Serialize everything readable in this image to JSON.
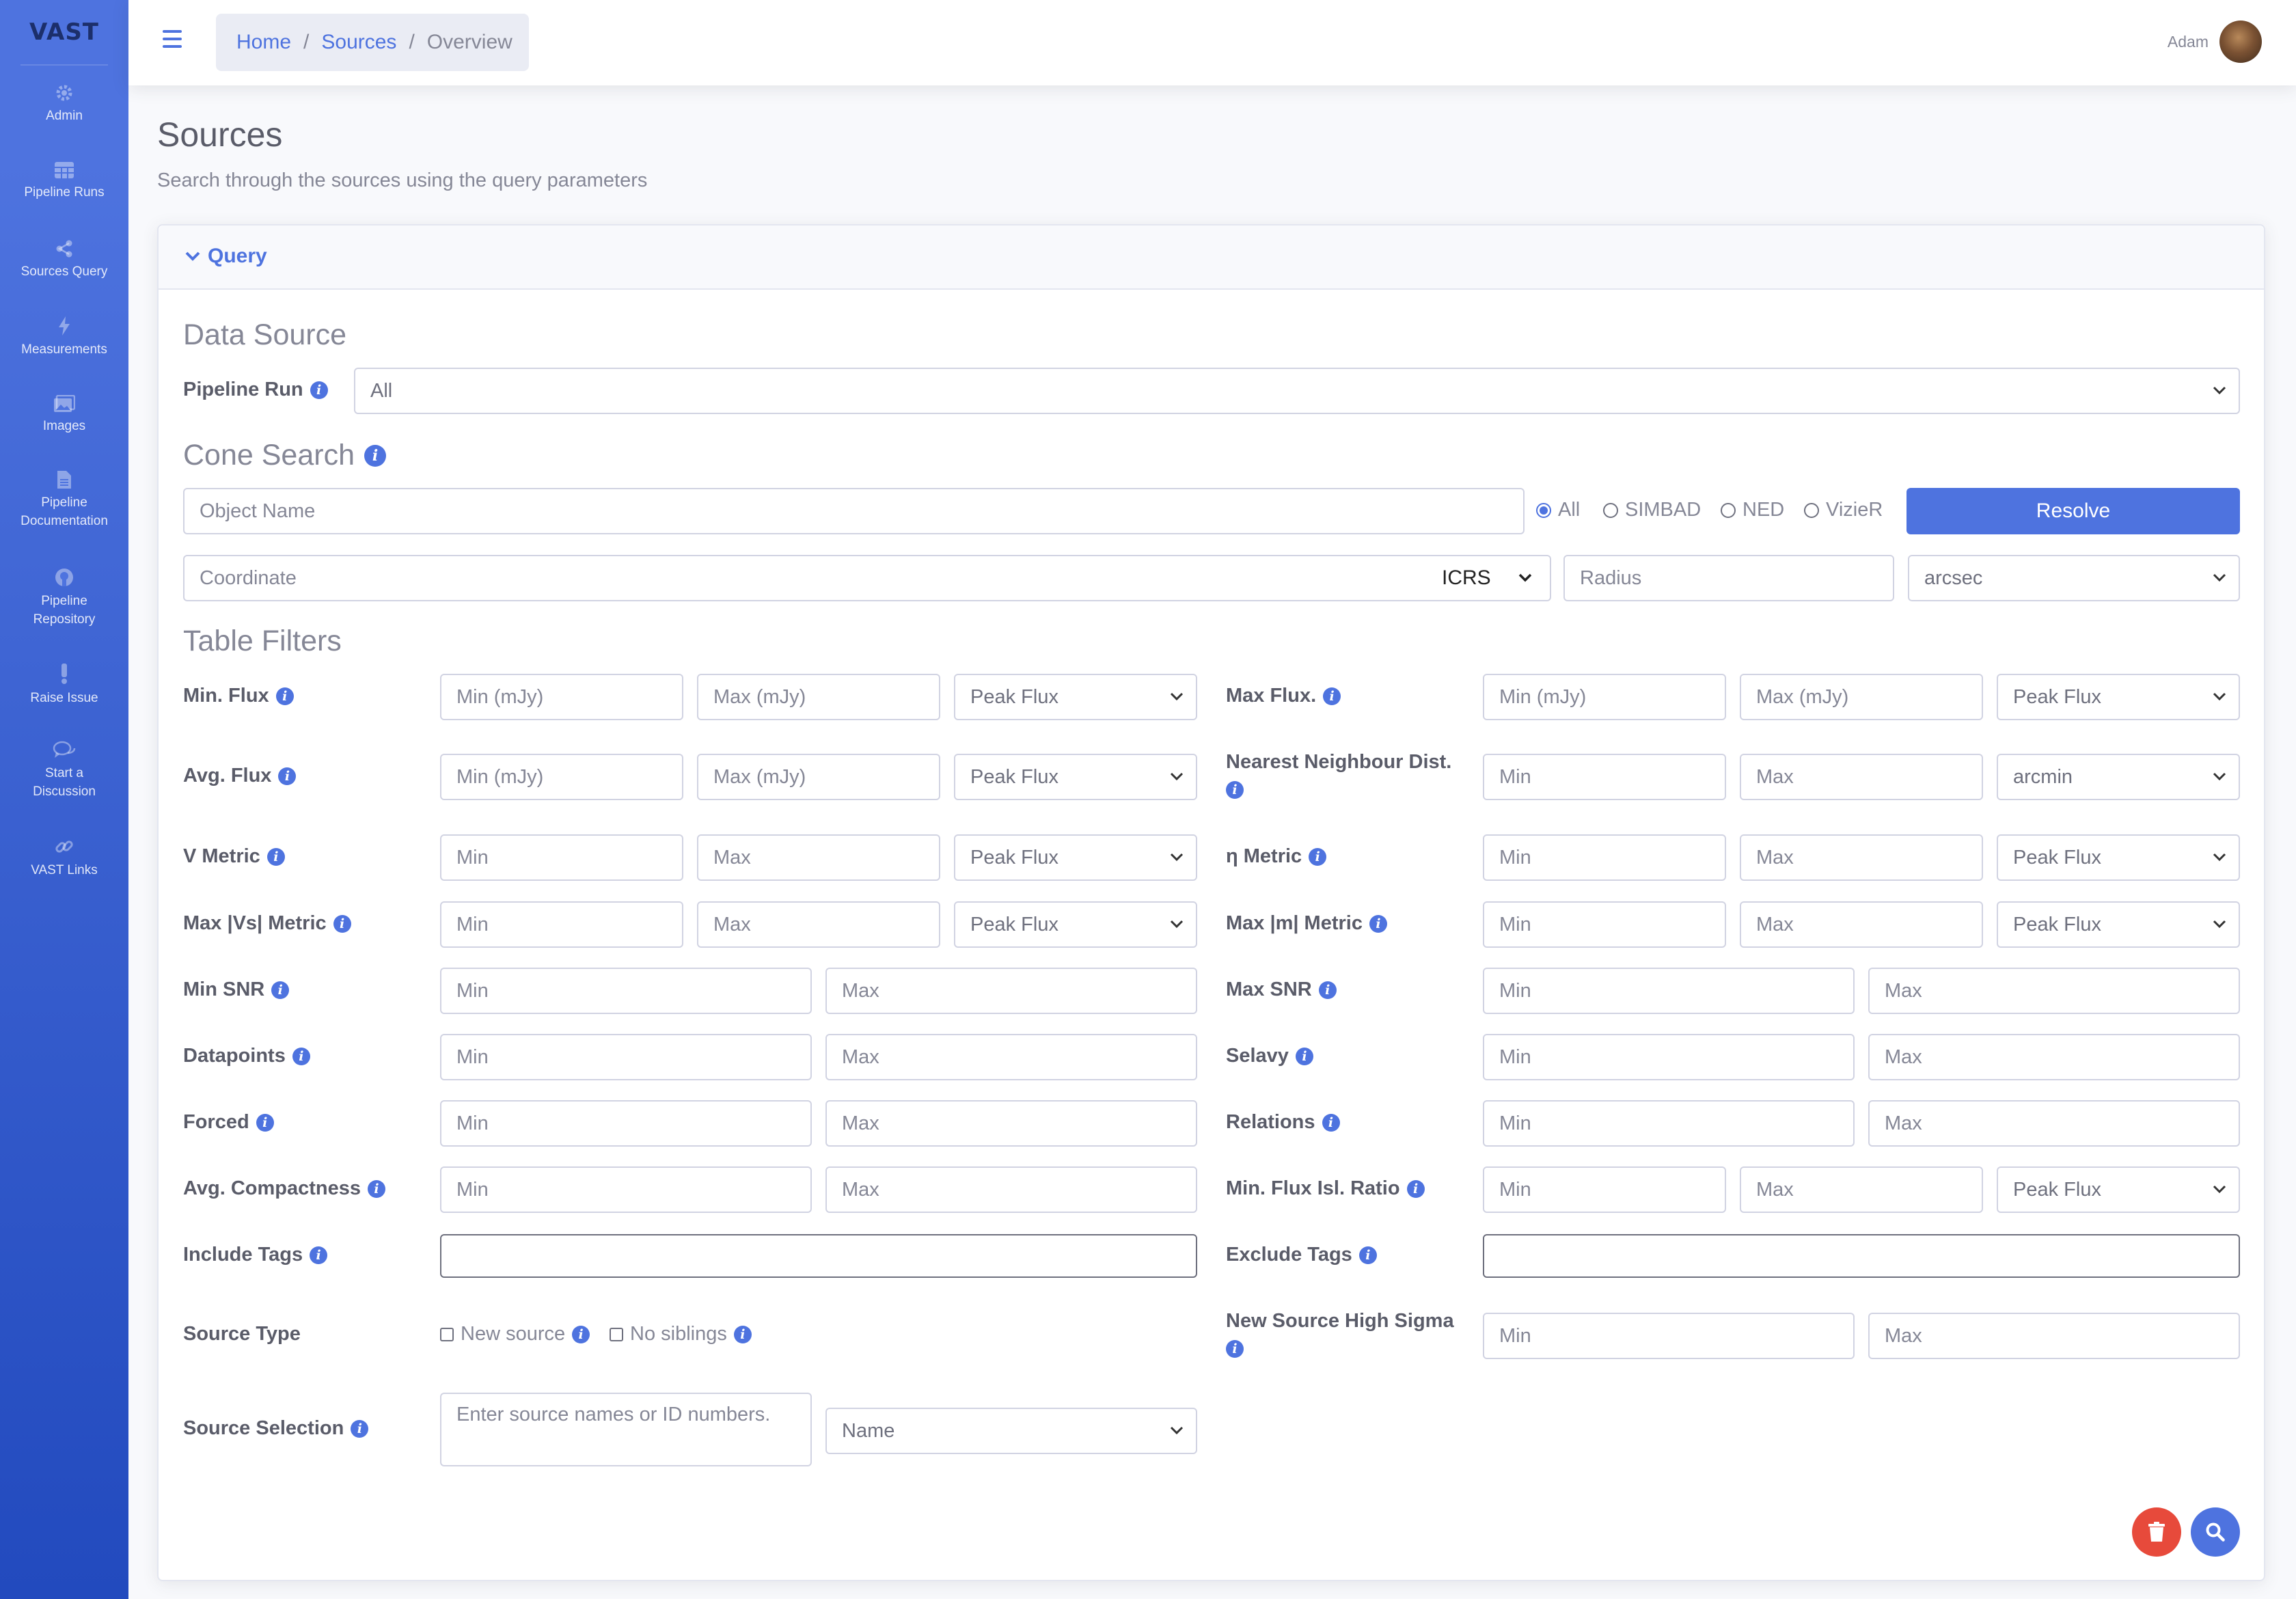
{
  "brand": "VAST",
  "sidebar": {
    "items": [
      {
        "label": "Admin",
        "icon": "gear-icon"
      },
      {
        "label": "Pipeline Runs",
        "icon": "table-icon"
      },
      {
        "label": "Sources Query",
        "icon": "share-icon"
      },
      {
        "label": "Measurements",
        "icon": "bolt-icon"
      },
      {
        "label": "Images",
        "icon": "images-icon"
      },
      {
        "label": "Pipeline Documentation",
        "label_lines": [
          "Pipeline",
          "Documentation"
        ],
        "icon": "file-icon"
      },
      {
        "label": "Pipeline Repository",
        "label_lines": [
          "Pipeline",
          "Repository"
        ],
        "icon": "github-icon"
      },
      {
        "label": "Raise Issue",
        "icon": "exclamation-icon"
      },
      {
        "label": "Start a Discussion",
        "label_lines": [
          "Start a",
          "Discussion"
        ],
        "icon": "comments-icon"
      },
      {
        "label": "VAST Links",
        "icon": "link-icon"
      }
    ]
  },
  "breadcrumb": {
    "home": "Home",
    "sources": "Sources",
    "current": "Overview"
  },
  "user": {
    "name": "Adam"
  },
  "page": {
    "title": "Sources",
    "subtitle": "Search through the sources using the query parameters"
  },
  "query": {
    "header": "Query",
    "data_source": {
      "heading": "Data Source",
      "pipeline_run_label": "Pipeline Run",
      "pipeline_run_value": "All"
    },
    "cone_search": {
      "heading": "Cone Search",
      "object_name_placeholder": "Object Name",
      "radios": [
        {
          "label": "All",
          "selected": true
        },
        {
          "label": "SIMBAD",
          "selected": false
        },
        {
          "label": "NED",
          "selected": false
        },
        {
          "label": "VizieR",
          "selected": false
        }
      ],
      "resolve_label": "Resolve",
      "coordinate_placeholder": "Coordinate",
      "frame_value": "ICRS",
      "radius_placeholder": "Radius",
      "radius_unit": "arcsec"
    },
    "table_filters": {
      "heading": "Table Filters",
      "min_flux": {
        "label": "Min. Flux",
        "min": "Min (mJy)",
        "max": "Max (mJy)",
        "select": "Peak Flux"
      },
      "max_flux": {
        "label": "Max Flux.",
        "min": "Min (mJy)",
        "max": "Max (mJy)",
        "select": "Peak Flux"
      },
      "avg_flux": {
        "label": "Avg. Flux",
        "min": "Min (mJy)",
        "max": "Max (mJy)",
        "select": "Peak Flux"
      },
      "nn_dist": {
        "label": "Nearest Neighbour Dist.",
        "min": "Min",
        "max": "Max",
        "select": "arcmin"
      },
      "v_metric": {
        "label": "V Metric",
        "min": "Min",
        "max": "Max",
        "select": "Peak Flux"
      },
      "eta_metric": {
        "label": "η Metric",
        "min": "Min",
        "max": "Max",
        "select": "Peak Flux"
      },
      "max_vs_metric": {
        "label": "Max |Vs| Metric",
        "min": "Min",
        "max": "Max",
        "select": "Peak Flux"
      },
      "max_m_metric": {
        "label": "Max |m| Metric",
        "min": "Min",
        "max": "Max",
        "select": "Peak Flux"
      },
      "min_snr": {
        "label": "Min SNR",
        "min": "Min",
        "max": "Max"
      },
      "max_snr": {
        "label": "Max SNR",
        "min": "Min",
        "max": "Max"
      },
      "datapoints": {
        "label": "Datapoints",
        "min": "Min",
        "max": "Max"
      },
      "selavy": {
        "label": "Selavy",
        "min": "Min",
        "max": "Max"
      },
      "forced": {
        "label": "Forced",
        "min": "Min",
        "max": "Max"
      },
      "relations": {
        "label": "Relations",
        "min": "Min",
        "max": "Max"
      },
      "avg_compactness": {
        "label": "Avg. Compactness",
        "min": "Min",
        "max": "Max"
      },
      "min_flux_isl_ratio": {
        "label": "Min. Flux Isl. Ratio",
        "min": "Min",
        "max": "Max",
        "select": "Peak Flux"
      },
      "include_tags": {
        "label": "Include Tags"
      },
      "exclude_tags": {
        "label": "Exclude Tags"
      },
      "source_type": {
        "label": "Source Type",
        "new_source": "New source",
        "no_siblings": "No siblings"
      },
      "new_source_high_sigma": {
        "label": "New Source High Sigma",
        "min": "Min",
        "max": "Max"
      },
      "source_selection": {
        "label": "Source Selection",
        "placeholder": "Enter source names or ID numbers.",
        "select": "Name"
      }
    }
  },
  "colors": {
    "primary": "#4e73df",
    "danger": "#e74a3b",
    "sidebar_top": "#4e73df",
    "sidebar_bottom": "#224abe"
  }
}
